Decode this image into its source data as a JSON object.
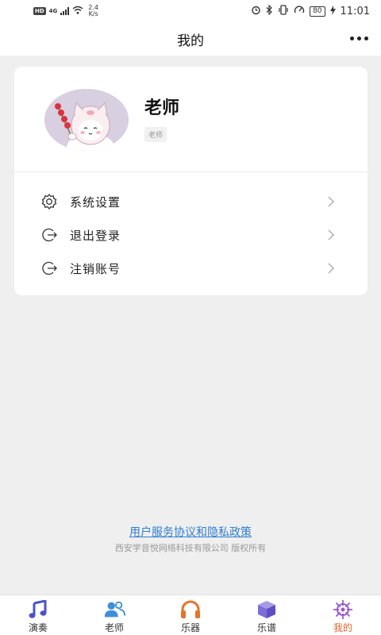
{
  "status_bar": {
    "hd": "HD",
    "network": "4G",
    "speed_value": "2.4",
    "speed_unit": "K/s",
    "battery": "80",
    "time": "11:01"
  },
  "header": {
    "title": "我的"
  },
  "profile": {
    "name": "老师",
    "role_tag": "老师"
  },
  "menu": {
    "items": [
      {
        "label": "系统设置",
        "icon": "gear-icon"
      },
      {
        "label": "退出登录",
        "icon": "logout-icon"
      },
      {
        "label": "注销账号",
        "icon": "logout-icon"
      }
    ]
  },
  "footer": {
    "agreement_link": "用户服务协议和隐私政策",
    "copyright": "西安学音悦网络科技有限公司 版权所有"
  },
  "tabbar": {
    "active_color": "#e0652a",
    "tabs": [
      {
        "label": "演奏",
        "icon": "music-note-icon"
      },
      {
        "label": "老师",
        "icon": "users-icon"
      },
      {
        "label": "乐器",
        "icon": "headphones-icon"
      },
      {
        "label": "乐谱",
        "icon": "box-icon"
      },
      {
        "label": "我的",
        "icon": "ship-wheel-icon",
        "active": true
      }
    ]
  }
}
